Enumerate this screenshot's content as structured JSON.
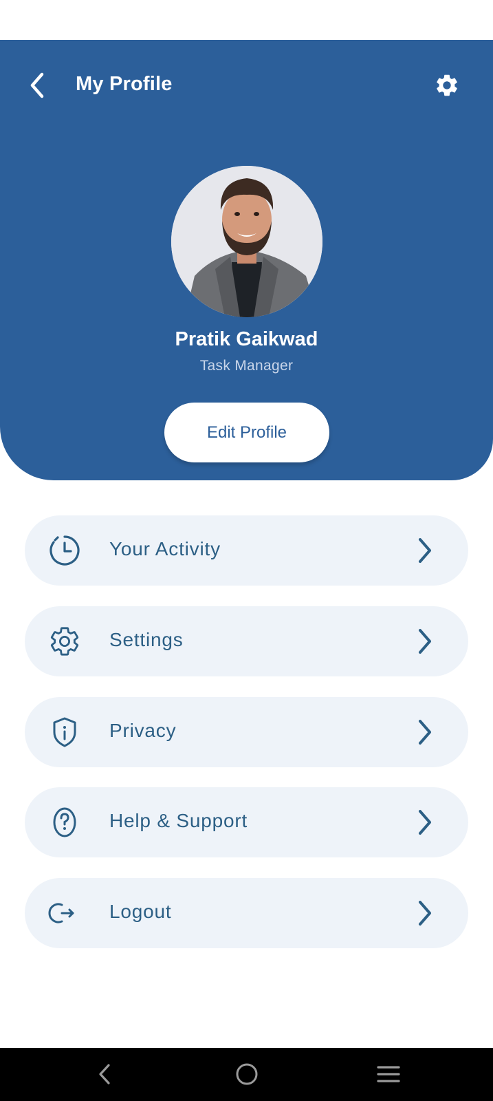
{
  "header": {
    "title": "My Profile",
    "back_icon": "chevron-left-icon",
    "settings_icon": "gear-icon",
    "background_color": "#2c5f9a"
  },
  "profile": {
    "name": "Pratik Gaikwad",
    "role": "Task Manager",
    "edit_button_label": "Edit Profile"
  },
  "menu": {
    "items": [
      {
        "label": "Your Activity",
        "icon": "clock-icon"
      },
      {
        "label": "Settings",
        "icon": "gear-icon"
      },
      {
        "label": "Privacy",
        "icon": "shield-info-icon"
      },
      {
        "label": "Help & Support",
        "icon": "help-circle-icon"
      },
      {
        "label": "Logout",
        "icon": "logout-icon"
      }
    ],
    "chevron_icon": "chevron-right-icon"
  },
  "system_nav": {
    "buttons": [
      "back-icon",
      "home-icon",
      "menu-icon"
    ]
  }
}
